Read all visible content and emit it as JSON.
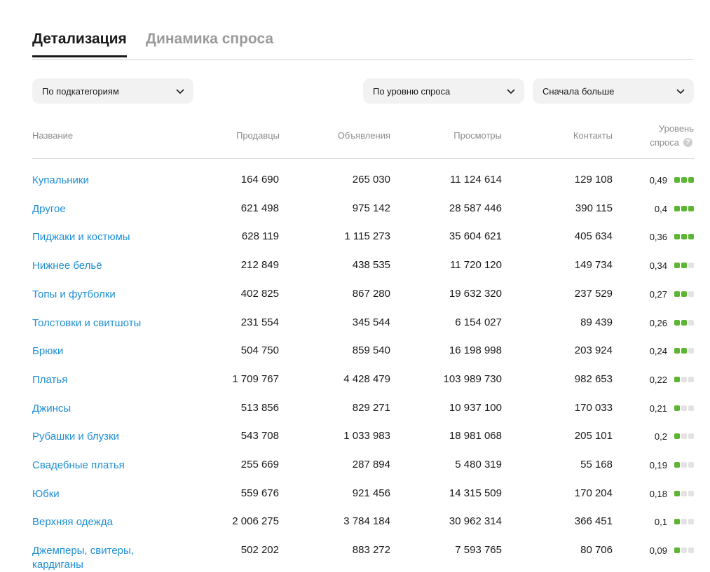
{
  "tabs": [
    {
      "label": "Детализация",
      "active": true
    },
    {
      "label": "Динамика спроса",
      "active": false
    }
  ],
  "filters": {
    "grouping": "По подкатегориям",
    "metric": "По уровню спроса",
    "order": "Сначала больше"
  },
  "columns": {
    "name": "Название",
    "sellers": "Продавцы",
    "ads": "Объявления",
    "views": "Просмотры",
    "contacts": "Контакты",
    "demand_line1": "Уровень",
    "demand_line2": "спроса"
  },
  "colors": {
    "link": "#1e8fd6",
    "demand_on": "#5db534",
    "demand_off": "#e3e3e3"
  },
  "rows": [
    {
      "name": "Купальники",
      "sellers": "164 690",
      "ads": "265 030",
      "views": "11 124 614",
      "contacts": "129 108",
      "level": "0,49",
      "bars": 3
    },
    {
      "name": "Другое",
      "sellers": "621 498",
      "ads": "975 142",
      "views": "28 587 446",
      "contacts": "390 115",
      "level": "0,4",
      "bars": 3
    },
    {
      "name": "Пиджаки и костюмы",
      "sellers": "628 119",
      "ads": "1 115 273",
      "views": "35 604 621",
      "contacts": "405 634",
      "level": "0,36",
      "bars": 3
    },
    {
      "name": "Нижнее бельё",
      "sellers": "212 849",
      "ads": "438 535",
      "views": "11 720 120",
      "contacts": "149 734",
      "level": "0,34",
      "bars": 2
    },
    {
      "name": "Топы и футболки",
      "sellers": "402 825",
      "ads": "867 280",
      "views": "19 632 320",
      "contacts": "237 529",
      "level": "0,27",
      "bars": 2
    },
    {
      "name": "Толстовки и свитшоты",
      "sellers": "231 554",
      "ads": "345 544",
      "views": "6 154 027",
      "contacts": "89 439",
      "level": "0,26",
      "bars": 2
    },
    {
      "name": "Брюки",
      "sellers": "504 750",
      "ads": "859 540",
      "views": "16 198 998",
      "contacts": "203 924",
      "level": "0,24",
      "bars": 2
    },
    {
      "name": "Платья",
      "sellers": "1 709 767",
      "ads": "4 428 479",
      "views": "103 989 730",
      "contacts": "982 653",
      "level": "0,22",
      "bars": 1
    },
    {
      "name": "Джинсы",
      "sellers": "513 856",
      "ads": "829 271",
      "views": "10 937 100",
      "contacts": "170 033",
      "level": "0,21",
      "bars": 1
    },
    {
      "name": "Рубашки и блузки",
      "sellers": "543 708",
      "ads": "1 033 983",
      "views": "18 981 068",
      "contacts": "205 101",
      "level": "0,2",
      "bars": 1
    },
    {
      "name": "Свадебные платья",
      "sellers": "255 669",
      "ads": "287 894",
      "views": "5 480 319",
      "contacts": "55 168",
      "level": "0,19",
      "bars": 1
    },
    {
      "name": "Юбки",
      "sellers": "559 676",
      "ads": "921 456",
      "views": "14 315 509",
      "contacts": "170 204",
      "level": "0,18",
      "bars": 1
    },
    {
      "name": "Верхняя одежда",
      "sellers": "2 006 275",
      "ads": "3 784 184",
      "views": "30 962 314",
      "contacts": "366 451",
      "level": "0,1",
      "bars": 1
    },
    {
      "name": "Джемперы, свитеры, кардиганы",
      "sellers": "502 202",
      "ads": "883 272",
      "views": "7 593 765",
      "contacts": "80 706",
      "level": "0,09",
      "bars": 1
    }
  ]
}
